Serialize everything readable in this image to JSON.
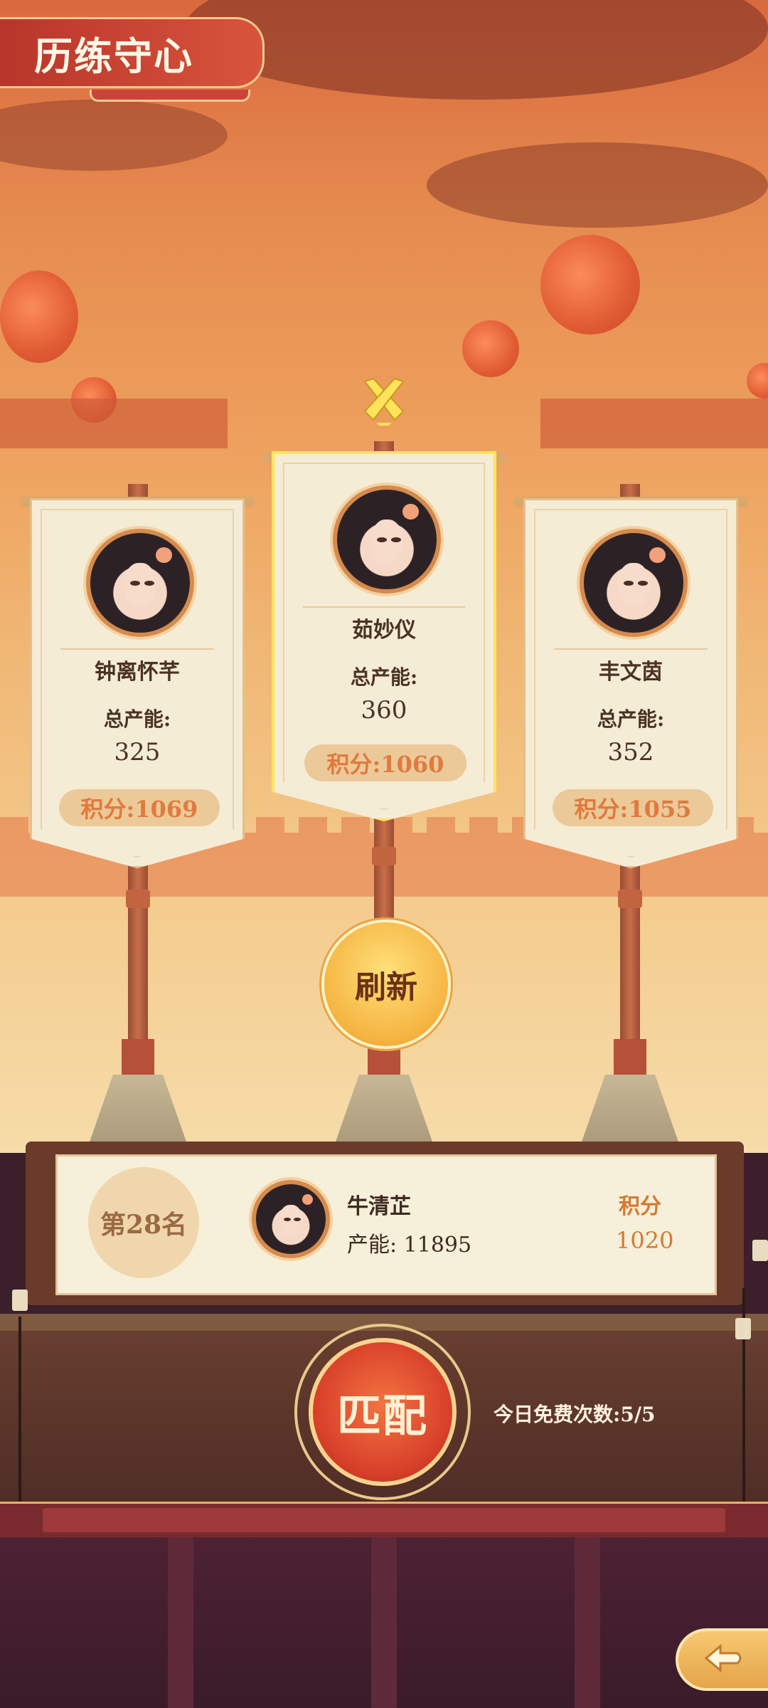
{
  "page": {
    "title": "历练守心"
  },
  "opponents": [
    {
      "name": "钟离怀芊",
      "power_label": "总产能:",
      "power": "325",
      "score": "积分:1069"
    },
    {
      "name": "茹妙仪",
      "power_label": "总产能:",
      "power": "360",
      "score": "积分:1060",
      "selected": true
    },
    {
      "name": "丰文茵",
      "power_label": "总产能:",
      "power": "352",
      "score": "积分:1055"
    }
  ],
  "refresh_label": "刷新",
  "me": {
    "rank": "第28名",
    "name": "牛清芷",
    "power": "产能: 11895",
    "score_label": "积分",
    "score": "1020"
  },
  "match": {
    "label": "匹配",
    "free_count": "今日免费次数:5/5"
  },
  "colors": {
    "accent": "#d8402a",
    "gold": "#f5b441",
    "selected_glow": "#ffe45a",
    "score_text": "#e07a3e"
  },
  "icons": {
    "crossed_swords": "crossed-swords-icon",
    "back": "back-arrow-icon"
  }
}
